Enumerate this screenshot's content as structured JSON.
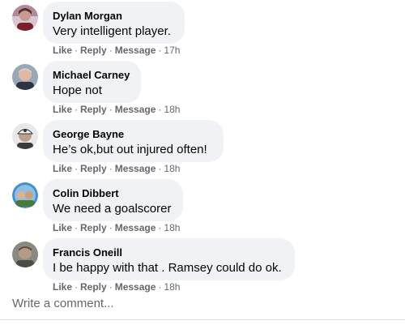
{
  "action_labels": {
    "like": "Like",
    "reply": "Reply",
    "message": "Message",
    "separator": "·"
  },
  "comments": [
    {
      "author": "Dylan Morgan",
      "text": "Very intelligent player.",
      "time": "17h"
    },
    {
      "author": "Michael Carney",
      "text": "Hope not",
      "time": "18h"
    },
    {
      "author": "George Bayne",
      "text": "He’s ok,but out injured often!",
      "time": "18h"
    },
    {
      "author": "Colin Dibbert",
      "text": "We need a goalscorer",
      "time": "18h"
    },
    {
      "author": "Francis Oneill",
      "text": "I be happy with that . Ramsey could do ok.",
      "time": "18h"
    }
  ],
  "composer": {
    "placeholder": "Write a comment..."
  },
  "colors": {
    "bubble": "#f0f2f5",
    "secondary_text": "#65676b",
    "primary_text": "#050505"
  }
}
